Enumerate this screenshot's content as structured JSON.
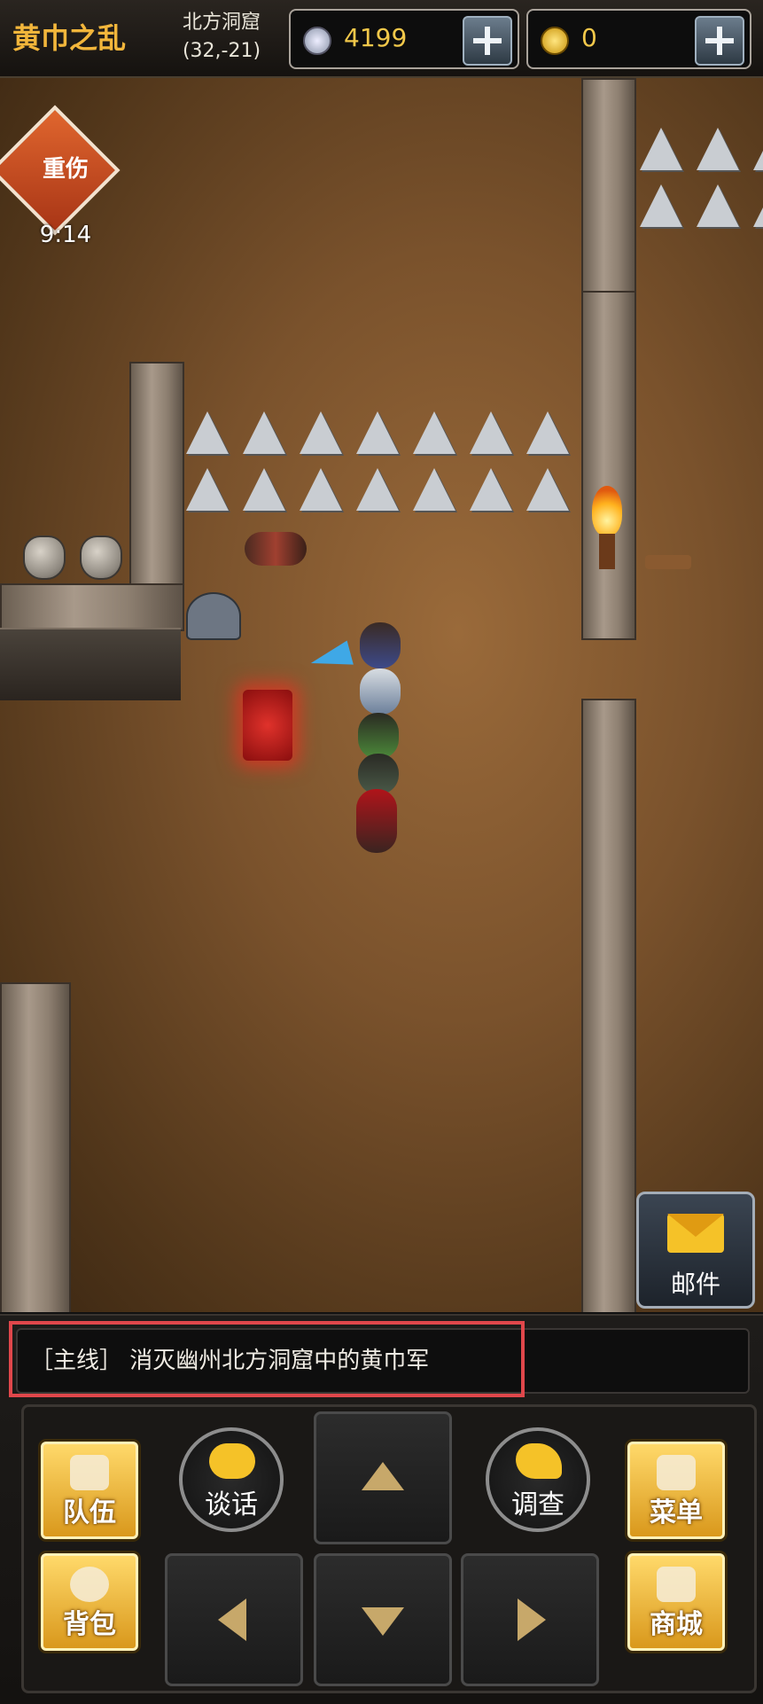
{
  "header": {
    "chapter": "黄巾之乱",
    "location_name": "北方洞窟",
    "location_coords": "(32,-21)",
    "silver": {
      "icon": "silver-coin-icon",
      "value": "4199"
    },
    "gold": {
      "icon": "gold-coin-icon",
      "value": "0"
    }
  },
  "status_effect": {
    "label": "重伤",
    "timer": "9:14",
    "color": "#c8441c"
  },
  "mail": {
    "label": "邮件",
    "icon": "envelope-icon"
  },
  "quest": {
    "text": "［主线］ 消灭幽州北方洞窟中的黄巾军",
    "highlight_color": "#e0474b"
  },
  "controls": {
    "team": "队伍",
    "bag": "背包",
    "talk": "谈话",
    "investigate": "调查",
    "menu": "菜单",
    "shop": "商城"
  },
  "colors": {
    "accent_gold": "#f2b63b",
    "button_yellow": "#f5c228"
  }
}
